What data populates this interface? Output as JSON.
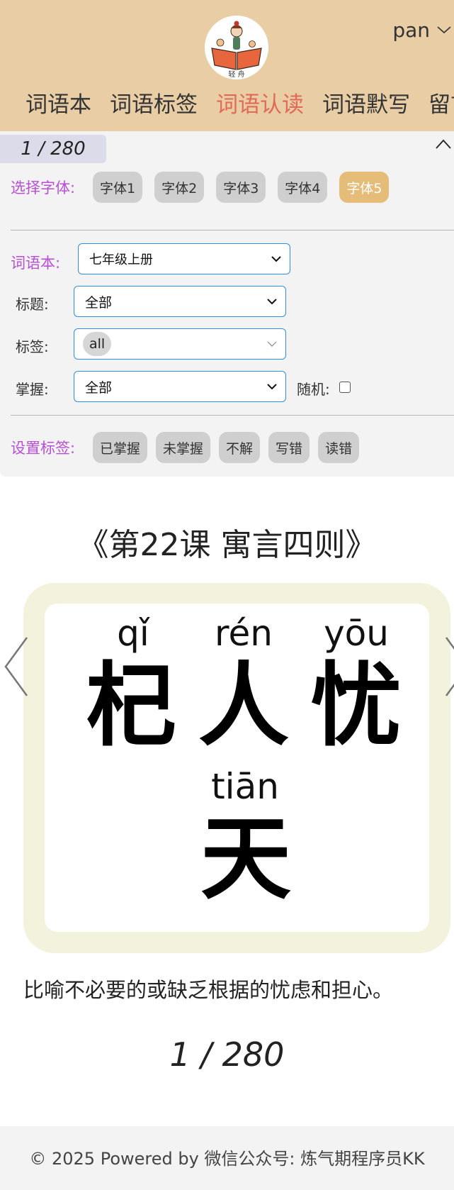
{
  "header": {
    "logo_text": "轻 舟",
    "user_name": "pan",
    "nav": [
      "词语本",
      "词语标签",
      "词语认读",
      "词语默写",
      "留言"
    ],
    "active_nav_index": 2
  },
  "panel": {
    "counter": "1 / 280",
    "font_label": "选择字体:",
    "fonts": [
      "字体1",
      "字体2",
      "字体3",
      "字体4",
      "字体5"
    ],
    "active_font_index": 4,
    "wordbook_label": "词语本:",
    "wordbook_value": "七年级上册",
    "title_label": "标题:",
    "title_value": "全部",
    "tag_label": "标签:",
    "tag_value": "all",
    "mastery_label": "掌握:",
    "mastery_value": "全部",
    "random_label": "随机:",
    "random_checked": false,
    "set_tag_label": "设置标签:",
    "set_tags": [
      "已掌握",
      "未掌握",
      "不解",
      "写错",
      "读错"
    ]
  },
  "card": {
    "lesson_title": "《第22课 寓言四则》",
    "chars": [
      {
        "pinyin": "qǐ",
        "hanzi": "杞"
      },
      {
        "pinyin": "rén",
        "hanzi": "人"
      },
      {
        "pinyin": "yōu",
        "hanzi": "忧"
      },
      {
        "pinyin": "tiān",
        "hanzi": "天"
      }
    ],
    "definition": "比喻不必要的或缺乏根据的忧虑和担心。",
    "page_counter": "1 / 280"
  },
  "footer": {
    "text": "© 2025 Powered by 微信公众号: 炼气期程序员KK"
  },
  "colors": {
    "header_bg": "#e8cda5",
    "active_nav": "#e06a57",
    "label_purple": "#b84fd6",
    "active_font_chip": "#e5bc78",
    "card_frame": "#f3f2dd",
    "select_border": "#2e8ee6"
  }
}
